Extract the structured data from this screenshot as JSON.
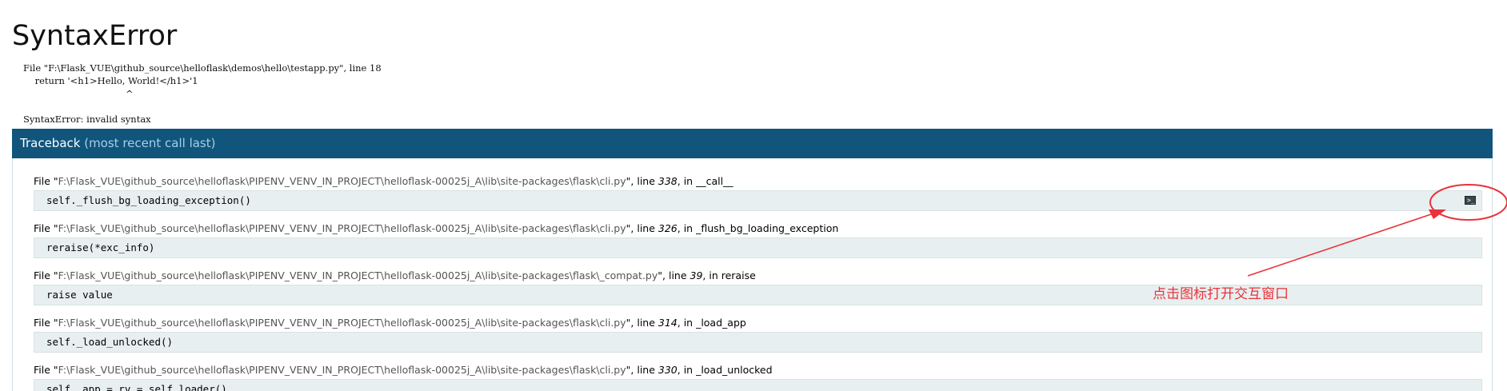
{
  "error": {
    "title": "SyntaxError",
    "summary_lines": [
      "File \"F:\\Flask_VUE\\github_source\\helloflask\\demos\\hello\\testapp.py\", line 18",
      "    return '<h1>Hello, World!</h1>'1",
      "                                   ^",
      "",
      "SyntaxError: invalid syntax"
    ]
  },
  "traceback": {
    "header_main": "Traceback",
    "header_sub": " (most recent call last)",
    "frames": [
      {
        "prefix": "File \"",
        "path": "F:\\Flask_VUE\\github_source\\helloflask\\PIPENV_VENV_IN_PROJECT\\helloflask-00025j_A\\lib\\site-packages\\flask\\cli.py",
        "mid": "\", line ",
        "lineno": "338",
        "suffix": ", in __call__",
        "code": "self._flush_bg_loading_exception()"
      },
      {
        "prefix": "File \"",
        "path": "F:\\Flask_VUE\\github_source\\helloflask\\PIPENV_VENV_IN_PROJECT\\helloflask-00025j_A\\lib\\site-packages\\flask\\cli.py",
        "mid": "\", line ",
        "lineno": "326",
        "suffix": ", in _flush_bg_loading_exception",
        "code": "reraise(*exc_info)"
      },
      {
        "prefix": "File \"",
        "path": "F:\\Flask_VUE\\github_source\\helloflask\\PIPENV_VENV_IN_PROJECT\\helloflask-00025j_A\\lib\\site-packages\\flask\\_compat.py",
        "mid": "\", line ",
        "lineno": "39",
        "suffix": ", in reraise",
        "code": "raise value"
      },
      {
        "prefix": "File \"",
        "path": "F:\\Flask_VUE\\github_source\\helloflask\\PIPENV_VENV_IN_PROJECT\\helloflask-00025j_A\\lib\\site-packages\\flask\\cli.py",
        "mid": "\", line ",
        "lineno": "314",
        "suffix": ", in _load_app",
        "code": "self._load_unlocked()"
      },
      {
        "prefix": "File \"",
        "path": "F:\\Flask_VUE\\github_source\\helloflask\\PIPENV_VENV_IN_PROJECT\\helloflask-00025j_A\\lib\\site-packages\\flask\\cli.py",
        "mid": "\", line ",
        "lineno": "330",
        "suffix": ", in _load_unlocked",
        "code": "self._app = rv = self.loader()"
      }
    ]
  },
  "console_icon": {
    "icon": "terminal-icon",
    "glyph": ">_"
  },
  "annotation": {
    "text": "点击图标打开交互窗口",
    "color": "#e8333b"
  },
  "colors": {
    "header_bg": "#11557c",
    "header_sub": "#a3d0e8",
    "code_bg": "#e8eff0"
  }
}
